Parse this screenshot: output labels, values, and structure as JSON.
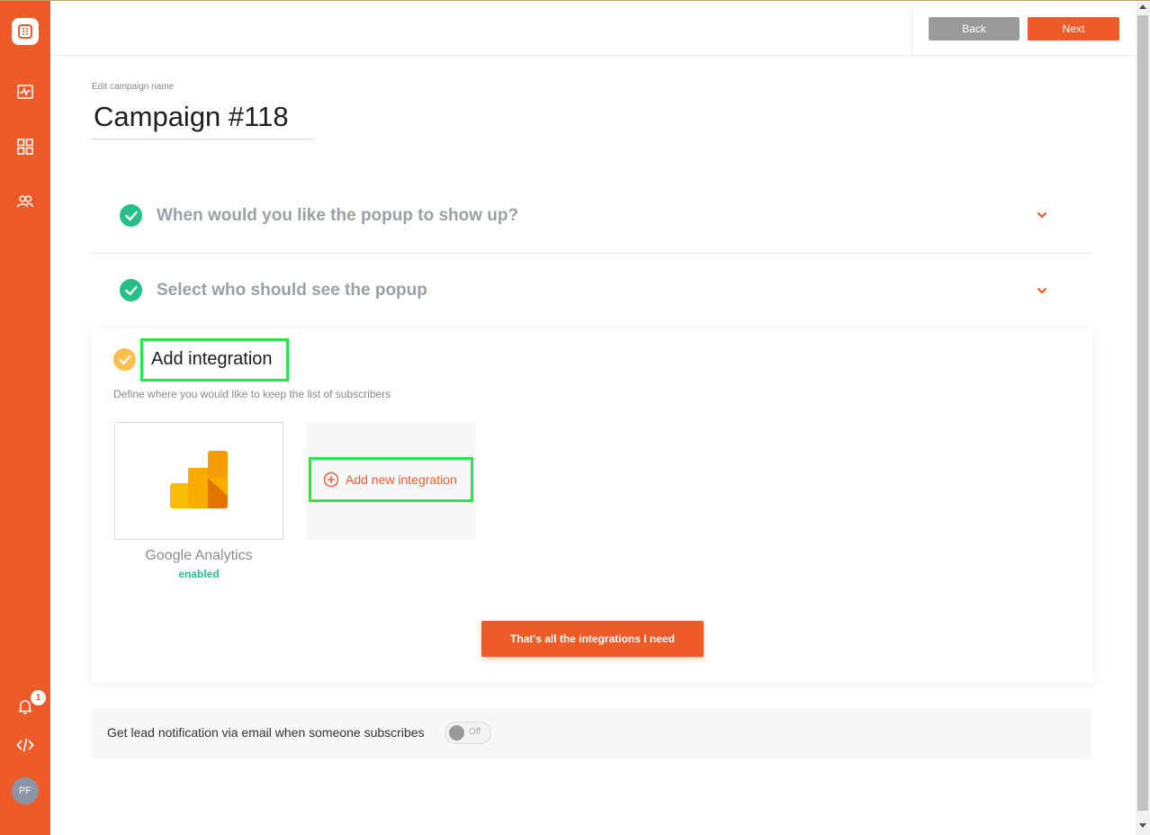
{
  "topbar": {
    "back_label": "Back",
    "next_label": "Next"
  },
  "sidebar": {
    "items": [
      {
        "icon": "logo-icon"
      },
      {
        "icon": "activity-icon"
      },
      {
        "icon": "dashboard-icon"
      },
      {
        "icon": "users-icon"
      }
    ],
    "notifications_badge": "1",
    "avatar_initials": "PF"
  },
  "campaign": {
    "edit_label": "Edit campaign name",
    "name": "Campaign #118"
  },
  "steps": [
    {
      "title": "When would you like the popup to show up?",
      "status": "complete"
    },
    {
      "title": "Select who should see the popup",
      "status": "complete"
    }
  ],
  "integration": {
    "title": "Add integration",
    "subtitle": "Define where you would like to keep the list of subscribers",
    "cards": [
      {
        "name": "Google Analytics",
        "status": "enabled"
      }
    ],
    "add_new_label": "Add new integration",
    "done_label": "That's all the integrations I need"
  },
  "lead_notification": {
    "label": "Get lead notification via email when someone subscribes",
    "toggle_label": "Off"
  },
  "colors": {
    "accent": "#ee5a28",
    "success": "#26bf87",
    "pending": "#fbbf4f",
    "highlight": "#27e83c"
  }
}
